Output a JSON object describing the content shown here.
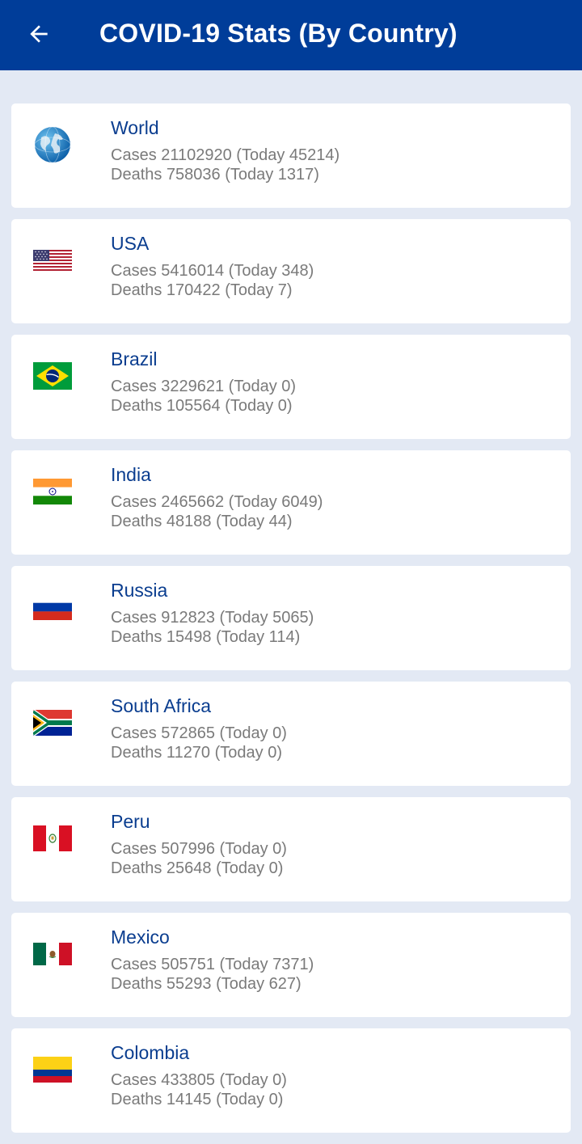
{
  "header": {
    "title": "COVID-19 Stats (By Country)",
    "back_icon": "arrow-left-icon",
    "background": "#003d99"
  },
  "countries": [
    {
      "name": "World",
      "flag": "globe-icon",
      "cases": "Cases 21102920 (Today 45214)",
      "deaths": "Deaths 758036 (Today 1317)"
    },
    {
      "name": "USA",
      "flag": "flag-usa-icon",
      "cases": "Cases 5416014 (Today 348)",
      "deaths": "Deaths 170422 (Today 7)"
    },
    {
      "name": "Brazil",
      "flag": "flag-brazil-icon",
      "cases": "Cases 3229621 (Today 0)",
      "deaths": "Deaths 105564 (Today 0)"
    },
    {
      "name": "India",
      "flag": "flag-india-icon",
      "cases": "Cases 2465662 (Today 6049)",
      "deaths": "Deaths 48188 (Today 44)"
    },
    {
      "name": "Russia",
      "flag": "flag-russia-icon",
      "cases": "Cases 912823 (Today 5065)",
      "deaths": "Deaths 15498 (Today 114)"
    },
    {
      "name": "South Africa",
      "flag": "flag-south-africa-icon",
      "cases": "Cases 572865 (Today 0)",
      "deaths": "Deaths 11270 (Today 0)"
    },
    {
      "name": "Peru",
      "flag": "flag-peru-icon",
      "cases": "Cases 507996 (Today 0)",
      "deaths": "Deaths 25648 (Today 0)"
    },
    {
      "name": "Mexico",
      "flag": "flag-mexico-icon",
      "cases": "Cases 505751 (Today 7371)",
      "deaths": "Deaths 55293 (Today 627)"
    },
    {
      "name": "Colombia",
      "flag": "flag-colombia-icon",
      "cases": "Cases 433805 (Today 0)",
      "deaths": "Deaths 14145 (Today 0)"
    }
  ]
}
